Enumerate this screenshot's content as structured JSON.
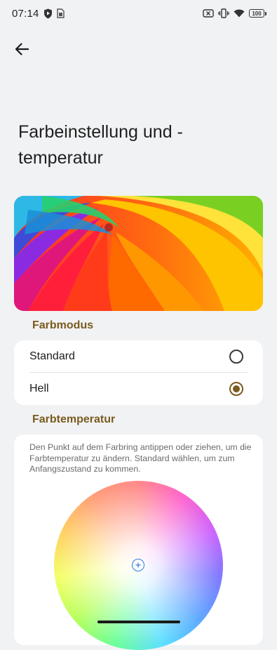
{
  "status_bar": {
    "time": "07:14",
    "battery": "100",
    "icons": [
      "shield-icon",
      "sim-card-icon",
      "no-sim-icon",
      "vibrate-icon",
      "wifi-icon",
      "battery-icon"
    ]
  },
  "header": {
    "back_icon": "arrow-left-icon",
    "title": "Farbeinstellung und -temperatur"
  },
  "color_mode": {
    "section_label": "Farbmodus",
    "options": [
      {
        "label": "Standard",
        "selected": false
      },
      {
        "label": "Hell",
        "selected": true
      }
    ]
  },
  "color_temperature": {
    "section_label": "Farbtemperatur",
    "description": "Den Punkt auf dem Farbring antippen oder ziehen, um die Farbtemperatur zu ändern. Standard wählen, um zum Anfangszustand zu kommen."
  },
  "colors": {
    "accent": "#7a5b1e",
    "background": "#f1f2f4",
    "card": "#ffffff",
    "picker": "#2a7be0"
  }
}
